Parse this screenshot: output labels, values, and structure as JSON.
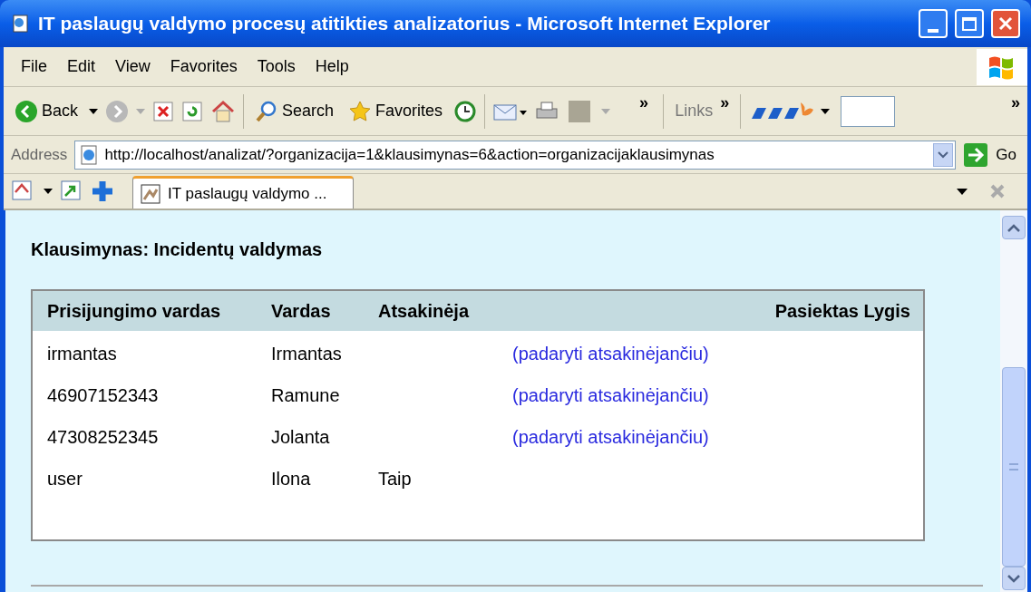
{
  "window": {
    "title": "IT paslaugų valdymo procesų atitikties analizatorius - Microsoft Internet Explorer"
  },
  "menu": [
    "File",
    "Edit",
    "View",
    "Favorites",
    "Tools",
    "Help"
  ],
  "toolbar": {
    "back": "Back",
    "search": "Search",
    "favorites": "Favorites",
    "chevron": "»",
    "links": "Links",
    "links_chevron": "»",
    "end_chevron": "»"
  },
  "address": {
    "label": "Address",
    "url": "http://localhost/analizat/?organizacija=1&klausimynas=6&action=organizacijaklausimynas",
    "go": "Go"
  },
  "tabs": [
    {
      "label": "IT paslaugų valdymo ...",
      "selected": true
    }
  ],
  "page": {
    "heading": "Klausimynas: Incidentų valdymas",
    "table": {
      "columns": [
        "Prisijungimo vardas",
        "Vardas",
        "Atsakinėja",
        "Pasiektas Lygis"
      ],
      "rows": [
        {
          "login": "irmantas",
          "name": "Irmantas",
          "action": "(padaryti atsakinėjančiu)"
        },
        {
          "login": "46907152343",
          "name": "Ramune",
          "action": "(padaryti atsakinėjančiu)"
        },
        {
          "login": "47308252345",
          "name": "Jolanta",
          "action": "(padaryti atsakinėjančiu)"
        },
        {
          "login": "user",
          "name": "Ilona",
          "responsible": "Taip"
        }
      ]
    }
  }
}
